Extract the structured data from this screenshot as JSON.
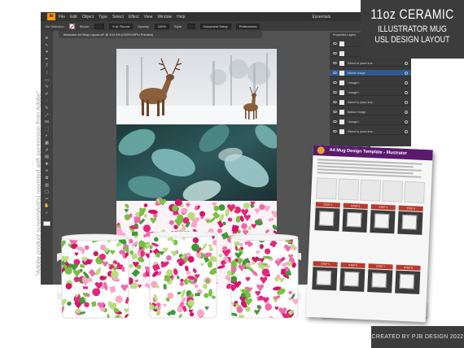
{
  "badge": {
    "line1": "11oz CERAMIC",
    "line2": "ILLUSTRATOR  MUG",
    "line3": "USL DESIGN LAYOUT"
  },
  "credit": "CREATED BY PJB DESIGN 2022",
  "side_note": "\"Adobe product screenshot(s) reprinted with permission from Adobe\"",
  "illustrator": {
    "app_logo": "Ai",
    "menu": [
      "File",
      "Edit",
      "Object",
      "Type",
      "Select",
      "Effect",
      "View",
      "Window",
      "Help"
    ],
    "workspace": "Essentials",
    "control_bar": {
      "selection": "No Selection",
      "stroke_label": "Stroke:",
      "stroke_style": "5 pt. Round",
      "opacity_label": "Opacity:",
      "opacity_value": "100%",
      "style_label": "Style:",
      "document_setup": "Document Setup",
      "preferences": "Preferences"
    },
    "doc_tab": "Illustrator A4 Mug Layout.ai* @ 104.5% (CMYK/GPU Preview)",
    "tools": [
      "arrow",
      "direct-select",
      "wand",
      "pen",
      "type",
      "line",
      "rect",
      "brush",
      "pencil",
      "eraser",
      "rotate",
      "scale",
      "width",
      "free-transform",
      "shape-builder",
      "perspective",
      "mesh",
      "gradient",
      "eyedropper",
      "blend",
      "symbol",
      "graph",
      "artboard",
      "slice",
      "hand",
      "zoom"
    ],
    "layers": {
      "tab": "Properties  Layers",
      "rows": [
        "",
        "",
        "Select to place ima...",
        "Middle Image",
        "<Image>",
        "<Image>",
        "Select to place ima...",
        "Bottom Image",
        "<Image>",
        "Select to place ima..."
      ]
    }
  },
  "template_sheet": {
    "title": "A4 Mug Design Template - Illustrator",
    "steps": [
      "STEP 1",
      "STEP 2",
      "STEP 3",
      "STEP 4",
      "STEP 5",
      "STEP 6",
      "STEP 7",
      "STEP 8"
    ]
  }
}
